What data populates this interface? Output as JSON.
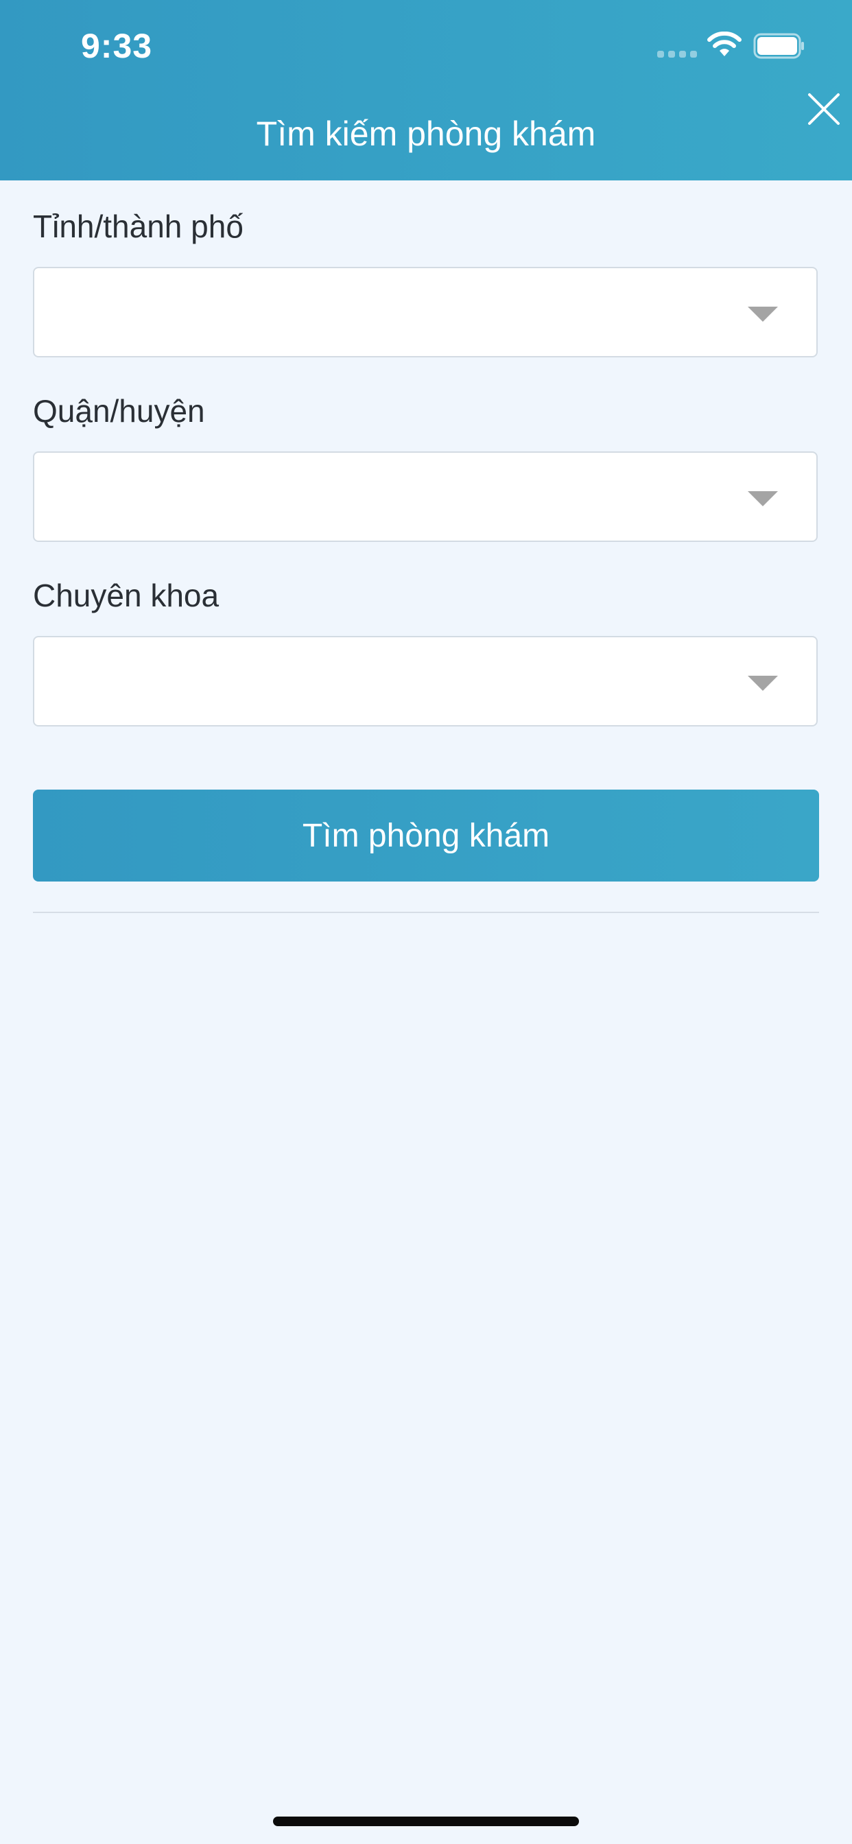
{
  "status_bar": {
    "time": "9:33"
  },
  "header": {
    "title": "Tìm kiếm phòng khám",
    "close_icon": "close-icon"
  },
  "form": {
    "fields": [
      {
        "label": "Tỉnh/thành phố",
        "value": ""
      },
      {
        "label": "Quận/huyện",
        "value": ""
      },
      {
        "label": "Chuyên khoa",
        "value": ""
      }
    ],
    "search_button_label": "Tìm phòng khám"
  },
  "colors": {
    "header_start": "#3399c2",
    "header_end": "#3aa9c9",
    "background": "#f0f6fd",
    "button": "#3399c2"
  }
}
